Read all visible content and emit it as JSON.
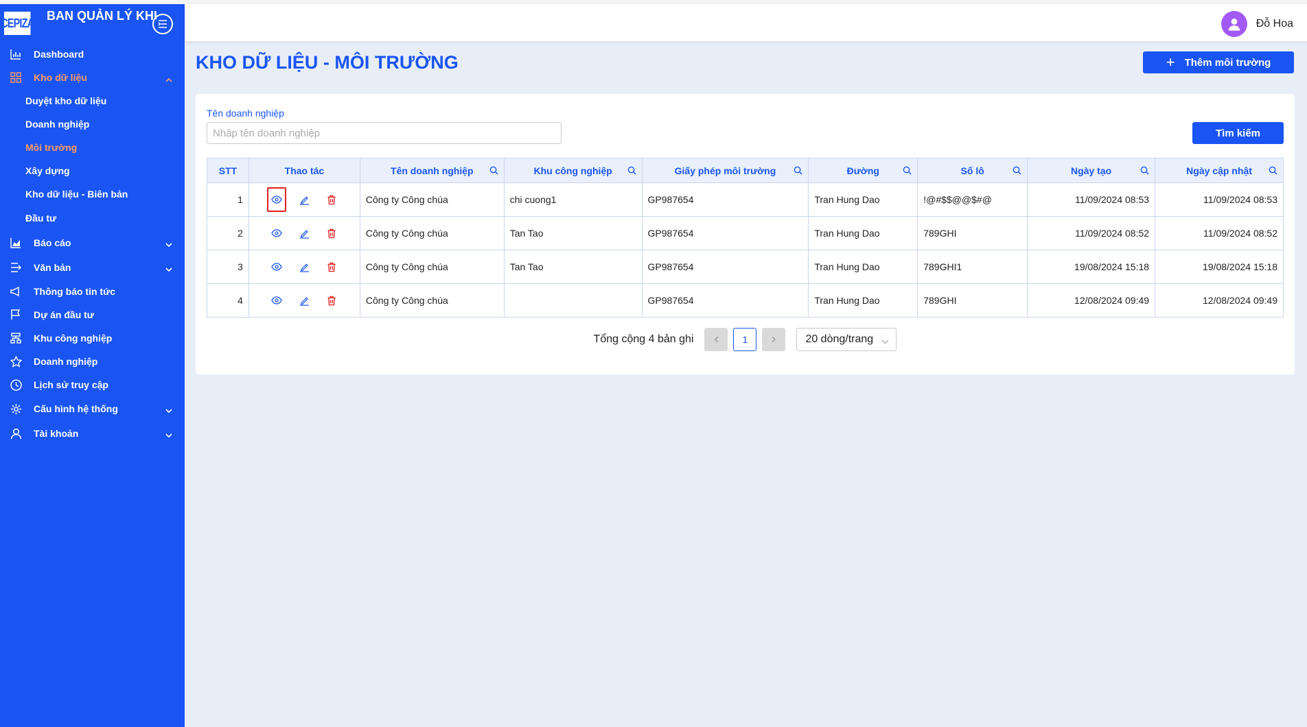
{
  "app": {
    "logo_text": "CEPIZA",
    "brand_title": "BAN QUẢN LÝ KHU CHẾ XUẤT KHU CN"
  },
  "sidebar": {
    "items": [
      {
        "label": "Dashboard",
        "icon": "bar-chart-icon"
      },
      {
        "label": "Kho dữ liệu",
        "icon": "grid-icon",
        "expanded": true,
        "active": true,
        "children": [
          {
            "label": "Duyệt kho dữ liệu"
          },
          {
            "label": "Doanh nghiệp"
          },
          {
            "label": "Môi trường",
            "active": true
          },
          {
            "label": "Xây dựng"
          },
          {
            "label": "Kho dữ liệu - Biên bản"
          },
          {
            "label": "Đầu tư"
          }
        ]
      },
      {
        "label": "Báo cáo",
        "icon": "area-chart-icon",
        "has_children": true
      },
      {
        "label": "Văn bản",
        "icon": "document-flow-icon",
        "has_children": true
      },
      {
        "label": "Thông báo tin tức",
        "icon": "megaphone-icon"
      },
      {
        "label": "Dự án đầu tư",
        "icon": "flag-icon"
      },
      {
        "label": "Khu công nghiệp",
        "icon": "hierarchy-icon"
      },
      {
        "label": "Doanh nghiệp",
        "icon": "star-icon"
      },
      {
        "label": "Lịch sử truy cập",
        "icon": "clock-icon"
      },
      {
        "label": "Cấu hình hệ thống",
        "icon": "gear-icon",
        "has_children": true
      },
      {
        "label": "Tài khoản",
        "icon": "user-icon",
        "has_children": true
      }
    ]
  },
  "header": {
    "user_name": "Đỗ Hoa"
  },
  "page": {
    "title": "KHO DỮ LIỆU - MÔI TRƯỜNG",
    "add_button_label": "Thêm môi trường"
  },
  "filter": {
    "label": "Tên doanh nghiệp",
    "placeholder": "Nhập tên doanh nghiệp",
    "value": "",
    "search_button_label": "Tìm kiếm"
  },
  "table": {
    "columns": [
      "STT",
      "Thao tác",
      "Tên doanh nghiệp",
      "Khu công nghiệp",
      "Giấy phép môi trường",
      "Đường",
      "Số lô",
      "Ngày tạo",
      "Ngày cập nhật"
    ],
    "rows": [
      {
        "stt": "1",
        "company": "Công ty Công chúa",
        "zone": "chi cuong1",
        "license": "GP987654",
        "street": "Tran Hung Dao",
        "lot": "!@#$$@@$#@",
        "created": "11/09/2024 08:53",
        "updated": "11/09/2024 08:53"
      },
      {
        "stt": "2",
        "company": "Công ty Công chúa",
        "zone": "Tan Tao",
        "license": "GP987654",
        "street": "Tran Hung Dao",
        "lot": "789GHI",
        "created": "11/09/2024 08:52",
        "updated": "11/09/2024 08:52"
      },
      {
        "stt": "3",
        "company": "Công ty Công chúa",
        "zone": "Tan Tao",
        "license": "GP987654",
        "street": "Tran Hung Dao",
        "lot": "789GHI1",
        "created": "19/08/2024 15:18",
        "updated": "19/08/2024 15:18"
      },
      {
        "stt": "4",
        "company": "Công ty Công chúa",
        "zone": "",
        "license": "GP987654",
        "street": "Tran Hung Dao",
        "lot": "789GHI",
        "created": "12/08/2024 09:49",
        "updated": "12/08/2024 09:49"
      }
    ]
  },
  "pagination": {
    "total_text": "Tổng cộng 4 bản ghi",
    "current_page": "1",
    "page_size": "20 dòng/trang"
  },
  "colors": {
    "primary": "#1a55f3",
    "active_menu": "#ff9b61",
    "delete": "#e02020",
    "avatar": "#a35af5"
  }
}
